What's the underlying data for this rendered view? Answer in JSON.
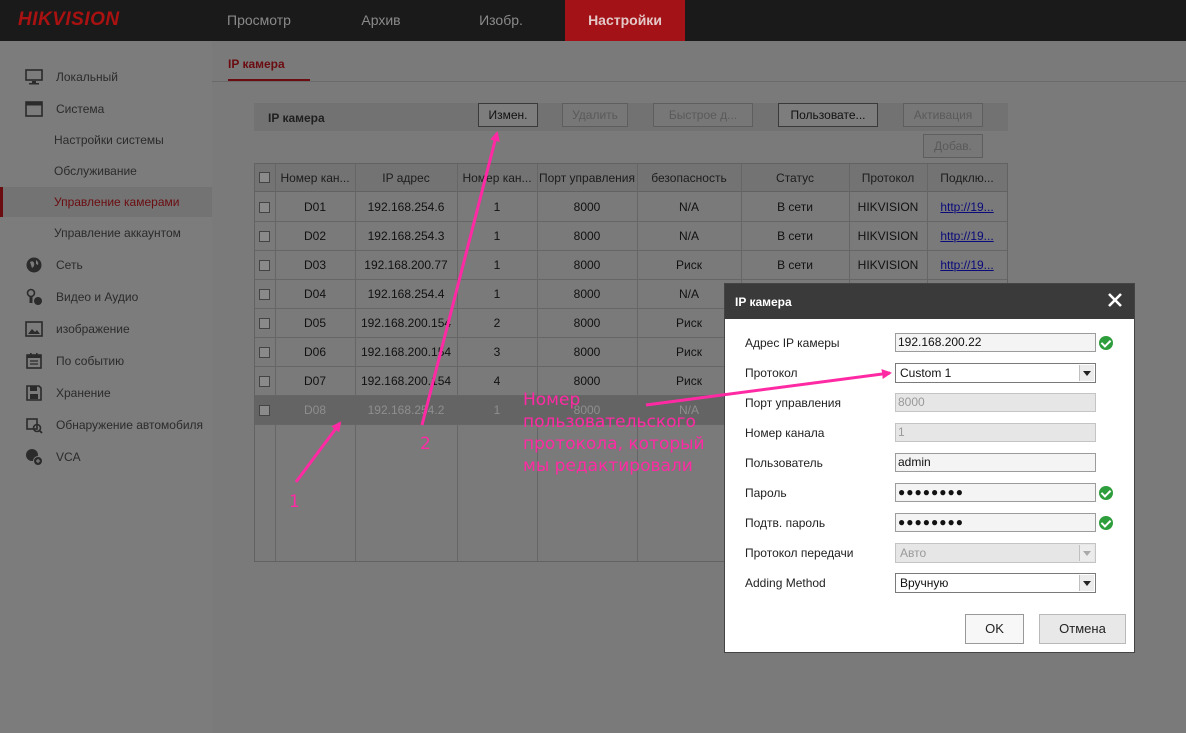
{
  "header": {
    "logo": "HIKVISION",
    "tabs": [
      "Просмотр",
      "Архив",
      "Изобр.",
      "Настройки"
    ],
    "active_tab": "Настройки"
  },
  "sidebar": {
    "items": [
      {
        "label": "Локальный",
        "icon": "monitor-icon"
      },
      {
        "label": "Система",
        "icon": "window-icon"
      },
      {
        "label": "Настройки системы",
        "sub": true
      },
      {
        "label": "Обслуживание",
        "sub": true
      },
      {
        "label": "Управление камерами",
        "sub": true,
        "active": true
      },
      {
        "label": "Управление аккаунтом",
        "sub": true
      },
      {
        "label": "Сеть",
        "icon": "globe-icon"
      },
      {
        "label": "Видео и Аудио",
        "icon": "audio-video-icon"
      },
      {
        "label": "изображение",
        "icon": "image-icon"
      },
      {
        "label": "По событию",
        "icon": "calendar-icon"
      },
      {
        "label": "Хранение",
        "icon": "floppy-icon"
      },
      {
        "label": "Обнаружение автомобиля",
        "icon": "vehicle-search-icon"
      },
      {
        "label": "VCA",
        "icon": "vca-icon"
      }
    ]
  },
  "main": {
    "subtab": "IP камера",
    "toolbar": {
      "title": "IP камера",
      "buttons": {
        "edit": "Измен.",
        "delete": "Удалить",
        "quick_add": "Быстрое д...",
        "user": "Пользовате...",
        "activate": "Активация",
        "add": "Добав."
      }
    },
    "table": {
      "headers": [
        "Номер кан...",
        "IP адрес",
        "Номер кан...",
        "Порт управления",
        "безопасность",
        "Статус",
        "Протокол",
        "Подклю..."
      ],
      "rows": [
        [
          "D01",
          "192.168.254.6",
          "1",
          "8000",
          "N/A",
          "В сети",
          "HIKVISION",
          "http://19..."
        ],
        [
          "D02",
          "192.168.254.3",
          "1",
          "8000",
          "N/A",
          "В сети",
          "HIKVISION",
          "http://19..."
        ],
        [
          "D03",
          "192.168.200.77",
          "1",
          "8000",
          "Риск",
          "В сети",
          "HIKVISION",
          "http://19..."
        ],
        [
          "D04",
          "192.168.254.4",
          "1",
          "8000",
          "N/A",
          "",
          "",
          ""
        ],
        [
          "D05",
          "192.168.200.154",
          "2",
          "8000",
          "Риск",
          "",
          "",
          ""
        ],
        [
          "D06",
          "192.168.200.154",
          "3",
          "8000",
          "Риск",
          "",
          "",
          ""
        ],
        [
          "D07",
          "192.168.200.154",
          "4",
          "8000",
          "Риск",
          "",
          "",
          ""
        ],
        [
          "D08",
          "192.168.254.2",
          "1",
          "8000",
          "N/A",
          "",
          "",
          ""
        ]
      ]
    }
  },
  "dialog": {
    "title": "IP камера",
    "fields": {
      "ip_label": "Адрес IP камеры",
      "ip_value": "192.168.200.22",
      "protocol_label": "Протокол",
      "protocol_value": "Custom 1",
      "port_label": "Порт управления",
      "port_value": "8000",
      "channel_label": "Номер канала",
      "channel_value": "1",
      "user_label": "Пользователь",
      "user_value": "admin",
      "password_label": "Пароль",
      "password_value": "●●●●●●●●",
      "confirm_label": "Подтв. пароль",
      "confirm_value": "●●●●●●●●",
      "transfer_label": "Протокол передачи",
      "transfer_value": "Авто",
      "method_label": "Adding Method",
      "method_value": "Вручную"
    },
    "ok": "OK",
    "cancel": "Отмена"
  },
  "annotations": {
    "marker_1": "1",
    "marker_2": "2",
    "note": "Номер пользовательского протокола, который мы редактировали",
    "color": "#ff2aa3"
  }
}
